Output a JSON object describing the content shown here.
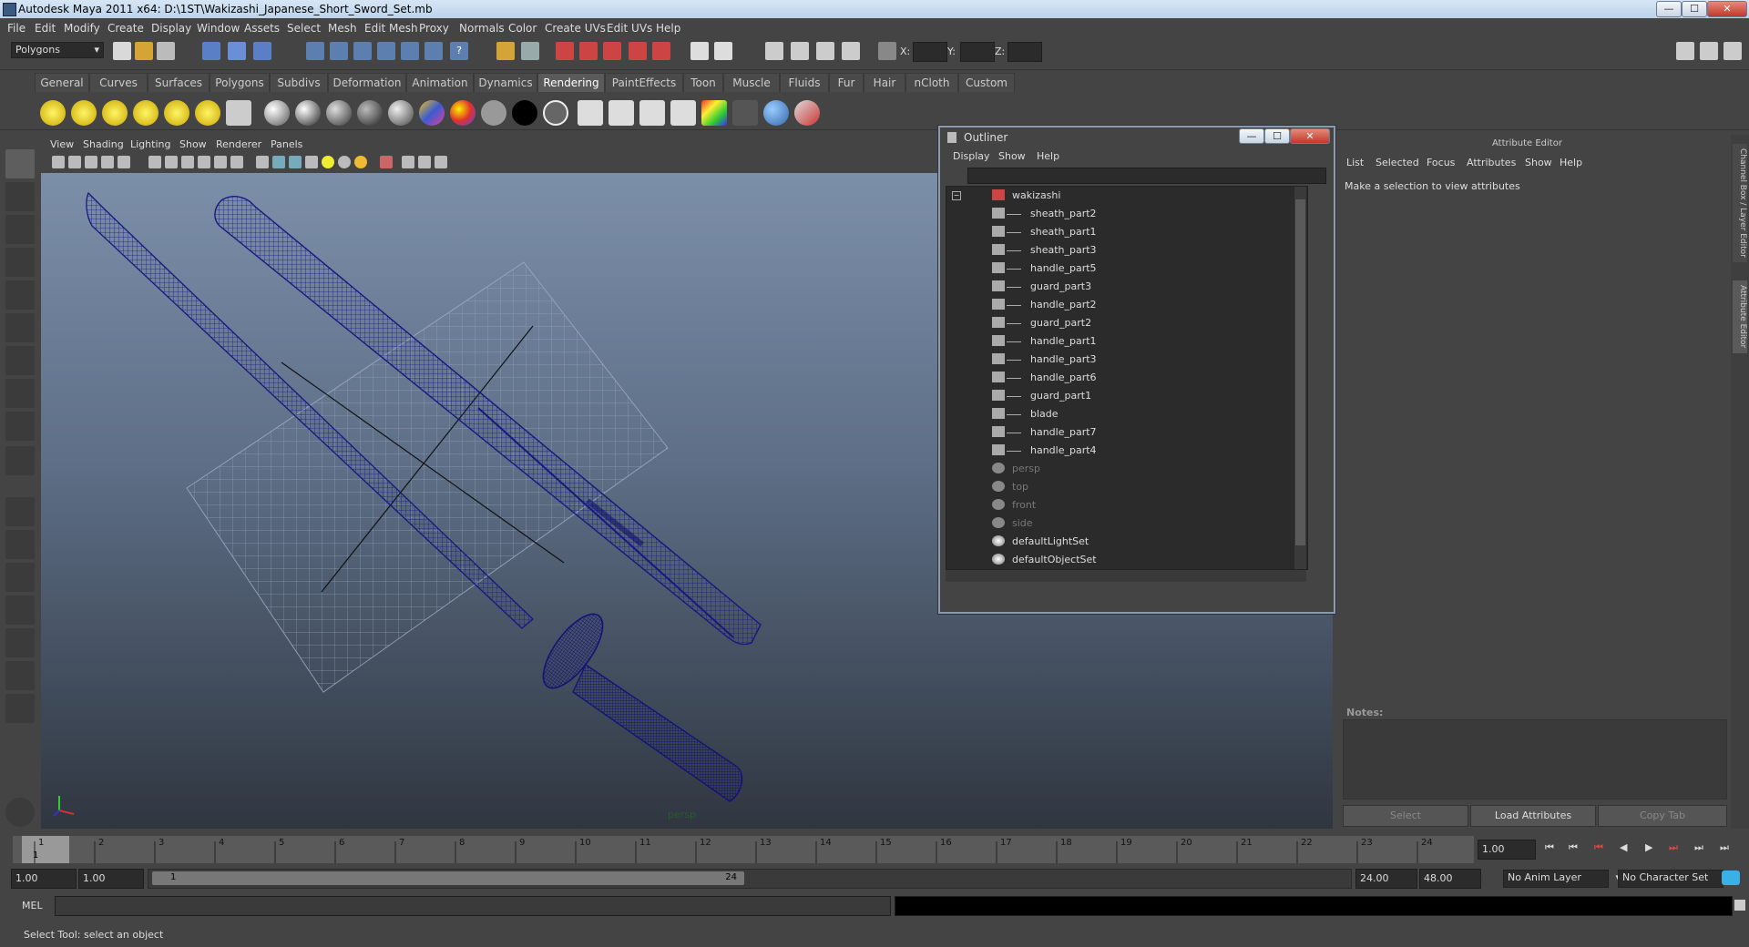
{
  "window": {
    "title": "Autodesk Maya 2011 x64: D:\\1ST\\Wakizashi_Japanese_Short_Sword_Set.mb",
    "minimize": "—",
    "maximize": "☐",
    "close": "✕"
  },
  "menubar": [
    "File",
    "Edit",
    "Modify",
    "Create",
    "Display",
    "Window",
    "Assets",
    "Select",
    "Mesh",
    "Edit Mesh",
    "Proxy",
    "Normals",
    "Color",
    "Create UVs",
    "Edit UVs",
    "Help"
  ],
  "toolbar": {
    "mode_dropdown": "Polygons",
    "x_label": "X:",
    "y_label": "Y:",
    "z_label": "Z:"
  },
  "shelf_tabs": [
    "General",
    "Curves",
    "Surfaces",
    "Polygons",
    "Subdivs",
    "Deformation",
    "Animation",
    "Dynamics",
    "Rendering",
    "PaintEffects",
    "Toon",
    "Muscle",
    "Fluids",
    "Fur",
    "Hair",
    "nCloth",
    "Custom"
  ],
  "active_shelf_tab": "Rendering",
  "viewport": {
    "menu": [
      "View",
      "Shading",
      "Lighting",
      "Show",
      "Renderer",
      "Panels"
    ],
    "camera_label": "persp"
  },
  "outliner": {
    "title": "Outliner",
    "menu": [
      "Display",
      "Show",
      "Help"
    ],
    "root": "wakizashi",
    "children": [
      "sheath_part2",
      "sheath_part1",
      "sheath_part3",
      "handle_part5",
      "guard_part3",
      "handle_part2",
      "guard_part2",
      "handle_part1",
      "handle_part3",
      "handle_part6",
      "guard_part1",
      "blade",
      "handle_part7",
      "handle_part4"
    ],
    "cameras": [
      "persp",
      "top",
      "front",
      "side"
    ],
    "sets": [
      "defaultLightSet",
      "defaultObjectSet"
    ]
  },
  "attribute_editor": {
    "title": "Attribute Editor",
    "menu": [
      "List",
      "Selected",
      "Focus",
      "Attributes",
      "Show",
      "Help"
    ],
    "message": "Make a selection to view attributes",
    "notes_label": "Notes:",
    "select_btn": "Select",
    "load_btn": "Load Attributes",
    "copy_btn": "Copy Tab",
    "side_tabs": [
      "Channel Box / Layer Editor",
      "Attribute Editor"
    ]
  },
  "timeline": {
    "ticks": [
      "1",
      "2",
      "3",
      "4",
      "5",
      "6",
      "7",
      "8",
      "9",
      "10",
      "11",
      "12",
      "13",
      "14",
      "15",
      "16",
      "17",
      "18",
      "19",
      "20",
      "21",
      "22",
      "23",
      "24"
    ],
    "current_frame": "1",
    "current_time_field": "1.00"
  },
  "range": {
    "start": "1.00",
    "playback_start": "1.00",
    "slider_start": "1",
    "slider_end": "24",
    "playback_end": "24.00",
    "end": "48.00",
    "anim_layer": "No Anim Layer",
    "character_set": "No Character Set"
  },
  "command_line": {
    "label": "MEL"
  },
  "help_line": "Select Tool: select an object"
}
